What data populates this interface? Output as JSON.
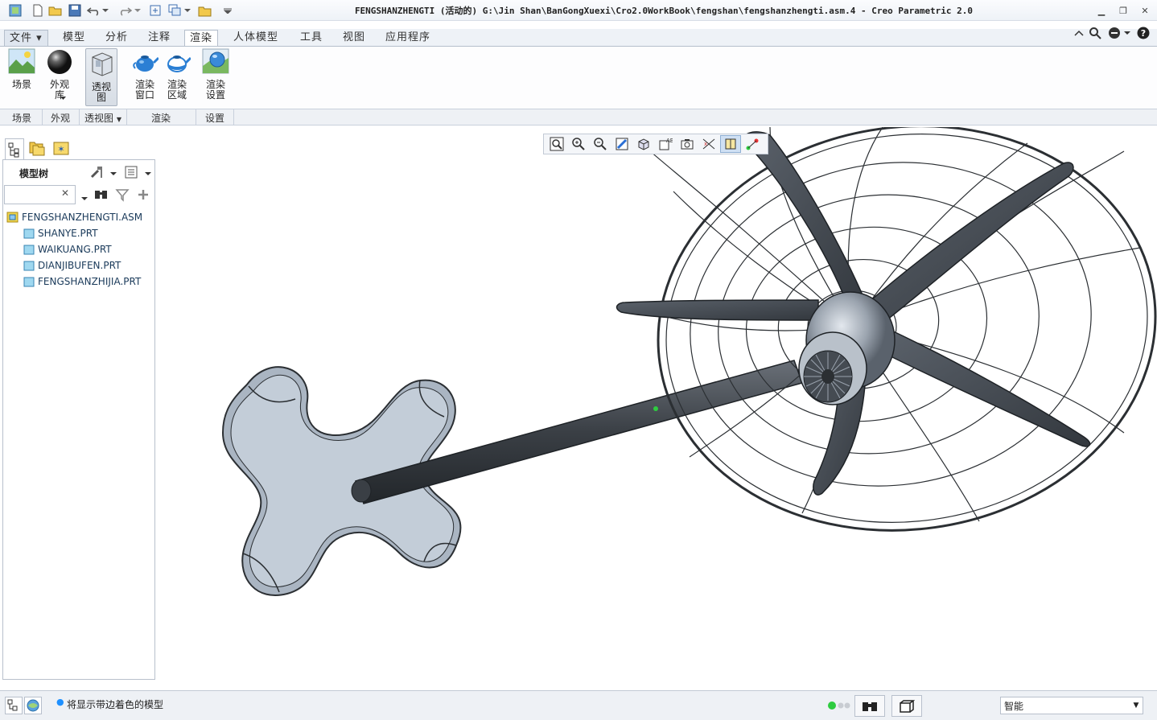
{
  "window": {
    "title": "FENGSHANZHENGTI (活动的) G:\\Jin Shan\\BanGongXuexi\\Cro2.0WorkBook\\fengshan\\fengshanzhengti.asm.4 - Creo Parametric 2.0"
  },
  "tabs": [
    {
      "label": "文件",
      "has_dropdown": true
    },
    {
      "label": "模型"
    },
    {
      "label": "分析"
    },
    {
      "label": "注释"
    },
    {
      "label": "渲染",
      "active": true
    },
    {
      "label": "人体模型"
    },
    {
      "label": "工具"
    },
    {
      "label": "视图"
    },
    {
      "label": "应用程序"
    }
  ],
  "ribbon": {
    "buttons": {
      "scene": {
        "label": "场景",
        "icon": "scene-icon"
      },
      "appearance": {
        "label": "外观\n库",
        "icon": "sphere-icon"
      },
      "perspective": {
        "label": "透视\n图",
        "icon": "perspective-cube-icon",
        "selected": true
      },
      "render_window": {
        "label": "渲染\n窗口",
        "icon": "teapot-icon"
      },
      "render_region": {
        "label": "渲染\n区域",
        "icon": "teapot-region-icon"
      },
      "render_settings": {
        "label": "渲染\n设置",
        "icon": "render-settings-icon"
      }
    },
    "groups": {
      "scene": "场景",
      "appearance": "外观",
      "perspective": "透视图",
      "render": "渲染",
      "settings": "设置"
    }
  },
  "model_tree": {
    "header": "模型树",
    "search_placeholder": "",
    "items": [
      {
        "label": "FENGSHANZHENGTI.ASM",
        "type": "assembly"
      },
      {
        "label": "SHANYE.PRT",
        "type": "part"
      },
      {
        "label": "WAIKUANG.PRT",
        "type": "part"
      },
      {
        "label": "DIANJIBUFEN.PRT",
        "type": "part"
      },
      {
        "label": "FENGSHANZHIJIA.PRT",
        "type": "part"
      }
    ]
  },
  "status": {
    "message": "将显示带边着色的模型",
    "filter_value": "智能"
  },
  "colors": {
    "accent": "#1e90ff",
    "part_fill": "#b8c6d6",
    "shaft": "#3a3f45",
    "blade": "#4a5058"
  }
}
